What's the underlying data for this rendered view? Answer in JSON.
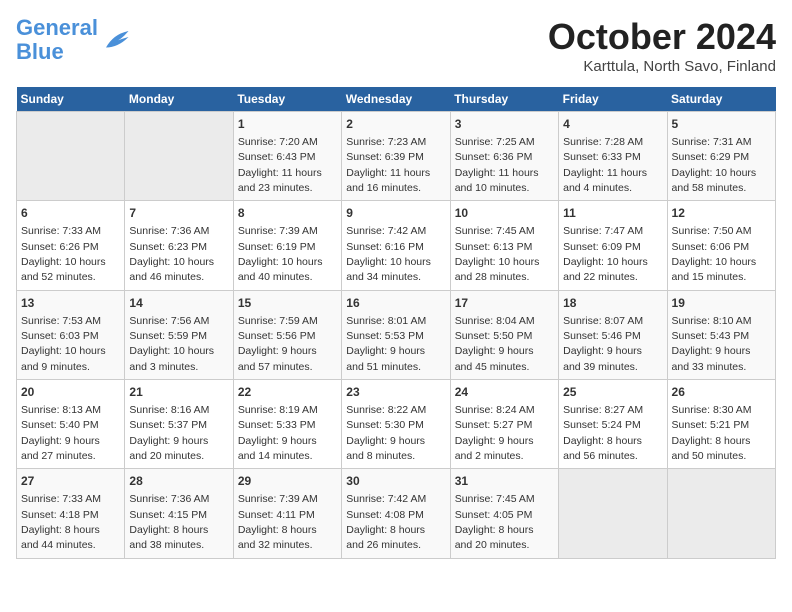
{
  "header": {
    "logo_line1": "General",
    "logo_line2": "Blue",
    "title": "October 2024",
    "subtitle": "Karttula, North Savo, Finland"
  },
  "days_of_week": [
    "Sunday",
    "Monday",
    "Tuesday",
    "Wednesday",
    "Thursday",
    "Friday",
    "Saturday"
  ],
  "weeks": [
    [
      {
        "day": "",
        "info": ""
      },
      {
        "day": "",
        "info": ""
      },
      {
        "day": "1",
        "info": "Sunrise: 7:20 AM\nSunset: 6:43 PM\nDaylight: 11 hours\nand 23 minutes."
      },
      {
        "day": "2",
        "info": "Sunrise: 7:23 AM\nSunset: 6:39 PM\nDaylight: 11 hours\nand 16 minutes."
      },
      {
        "day": "3",
        "info": "Sunrise: 7:25 AM\nSunset: 6:36 PM\nDaylight: 11 hours\nand 10 minutes."
      },
      {
        "day": "4",
        "info": "Sunrise: 7:28 AM\nSunset: 6:33 PM\nDaylight: 11 hours\nand 4 minutes."
      },
      {
        "day": "5",
        "info": "Sunrise: 7:31 AM\nSunset: 6:29 PM\nDaylight: 10 hours\nand 58 minutes."
      }
    ],
    [
      {
        "day": "6",
        "info": "Sunrise: 7:33 AM\nSunset: 6:26 PM\nDaylight: 10 hours\nand 52 minutes."
      },
      {
        "day": "7",
        "info": "Sunrise: 7:36 AM\nSunset: 6:23 PM\nDaylight: 10 hours\nand 46 minutes."
      },
      {
        "day": "8",
        "info": "Sunrise: 7:39 AM\nSunset: 6:19 PM\nDaylight: 10 hours\nand 40 minutes."
      },
      {
        "day": "9",
        "info": "Sunrise: 7:42 AM\nSunset: 6:16 PM\nDaylight: 10 hours\nand 34 minutes."
      },
      {
        "day": "10",
        "info": "Sunrise: 7:45 AM\nSunset: 6:13 PM\nDaylight: 10 hours\nand 28 minutes."
      },
      {
        "day": "11",
        "info": "Sunrise: 7:47 AM\nSunset: 6:09 PM\nDaylight: 10 hours\nand 22 minutes."
      },
      {
        "day": "12",
        "info": "Sunrise: 7:50 AM\nSunset: 6:06 PM\nDaylight: 10 hours\nand 15 minutes."
      }
    ],
    [
      {
        "day": "13",
        "info": "Sunrise: 7:53 AM\nSunset: 6:03 PM\nDaylight: 10 hours\nand 9 minutes."
      },
      {
        "day": "14",
        "info": "Sunrise: 7:56 AM\nSunset: 5:59 PM\nDaylight: 10 hours\nand 3 minutes."
      },
      {
        "day": "15",
        "info": "Sunrise: 7:59 AM\nSunset: 5:56 PM\nDaylight: 9 hours\nand 57 minutes."
      },
      {
        "day": "16",
        "info": "Sunrise: 8:01 AM\nSunset: 5:53 PM\nDaylight: 9 hours\nand 51 minutes."
      },
      {
        "day": "17",
        "info": "Sunrise: 8:04 AM\nSunset: 5:50 PM\nDaylight: 9 hours\nand 45 minutes."
      },
      {
        "day": "18",
        "info": "Sunrise: 8:07 AM\nSunset: 5:46 PM\nDaylight: 9 hours\nand 39 minutes."
      },
      {
        "day": "19",
        "info": "Sunrise: 8:10 AM\nSunset: 5:43 PM\nDaylight: 9 hours\nand 33 minutes."
      }
    ],
    [
      {
        "day": "20",
        "info": "Sunrise: 8:13 AM\nSunset: 5:40 PM\nDaylight: 9 hours\nand 27 minutes."
      },
      {
        "day": "21",
        "info": "Sunrise: 8:16 AM\nSunset: 5:37 PM\nDaylight: 9 hours\nand 20 minutes."
      },
      {
        "day": "22",
        "info": "Sunrise: 8:19 AM\nSunset: 5:33 PM\nDaylight: 9 hours\nand 14 minutes."
      },
      {
        "day": "23",
        "info": "Sunrise: 8:22 AM\nSunset: 5:30 PM\nDaylight: 9 hours\nand 8 minutes."
      },
      {
        "day": "24",
        "info": "Sunrise: 8:24 AM\nSunset: 5:27 PM\nDaylight: 9 hours\nand 2 minutes."
      },
      {
        "day": "25",
        "info": "Sunrise: 8:27 AM\nSunset: 5:24 PM\nDaylight: 8 hours\nand 56 minutes."
      },
      {
        "day": "26",
        "info": "Sunrise: 8:30 AM\nSunset: 5:21 PM\nDaylight: 8 hours\nand 50 minutes."
      }
    ],
    [
      {
        "day": "27",
        "info": "Sunrise: 7:33 AM\nSunset: 4:18 PM\nDaylight: 8 hours\nand 44 minutes."
      },
      {
        "day": "28",
        "info": "Sunrise: 7:36 AM\nSunset: 4:15 PM\nDaylight: 8 hours\nand 38 minutes."
      },
      {
        "day": "29",
        "info": "Sunrise: 7:39 AM\nSunset: 4:11 PM\nDaylight: 8 hours\nand 32 minutes."
      },
      {
        "day": "30",
        "info": "Sunrise: 7:42 AM\nSunset: 4:08 PM\nDaylight: 8 hours\nand 26 minutes."
      },
      {
        "day": "31",
        "info": "Sunrise: 7:45 AM\nSunset: 4:05 PM\nDaylight: 8 hours\nand 20 minutes."
      },
      {
        "day": "",
        "info": ""
      },
      {
        "day": "",
        "info": ""
      }
    ]
  ]
}
